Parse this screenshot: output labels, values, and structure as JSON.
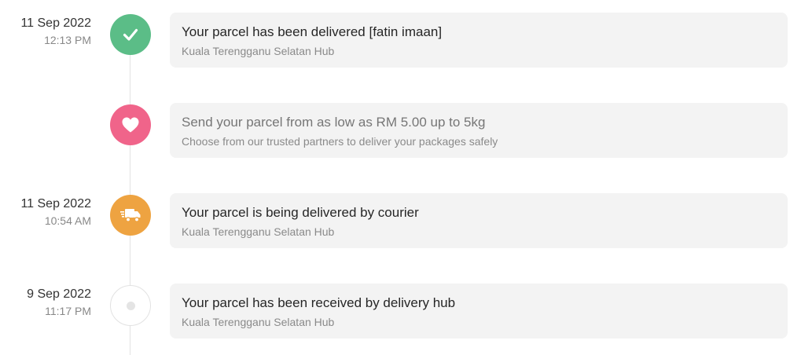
{
  "events": [
    {
      "date": "11 Sep 2022",
      "time": "12:13 PM",
      "icon": "check-icon",
      "color": "#5bbd87",
      "title": "Your parcel has been delivered [fatin imaan]",
      "subtitle": "Kuala Terengganu Selatan Hub"
    },
    {
      "date": "",
      "time": "",
      "icon": "heart-icon",
      "color": "#f0648a",
      "title": "Send your parcel from as low as RM 5.00 up to 5kg",
      "subtitle": "Choose from our trusted partners to deliver your packages safely"
    },
    {
      "date": "11 Sep 2022",
      "time": "10:54 AM",
      "icon": "delivery-truck-icon",
      "color": "#eea341",
      "title": "Your parcel is being delivered by courier",
      "subtitle": "Kuala Terengganu Selatan Hub"
    },
    {
      "date": "9 Sep 2022",
      "time": "11:17 PM",
      "icon": "pending-dot-icon",
      "color": "#e4e4e4",
      "title": "Your parcel has been received by delivery hub",
      "subtitle": "Kuala Terengganu Selatan Hub"
    }
  ]
}
